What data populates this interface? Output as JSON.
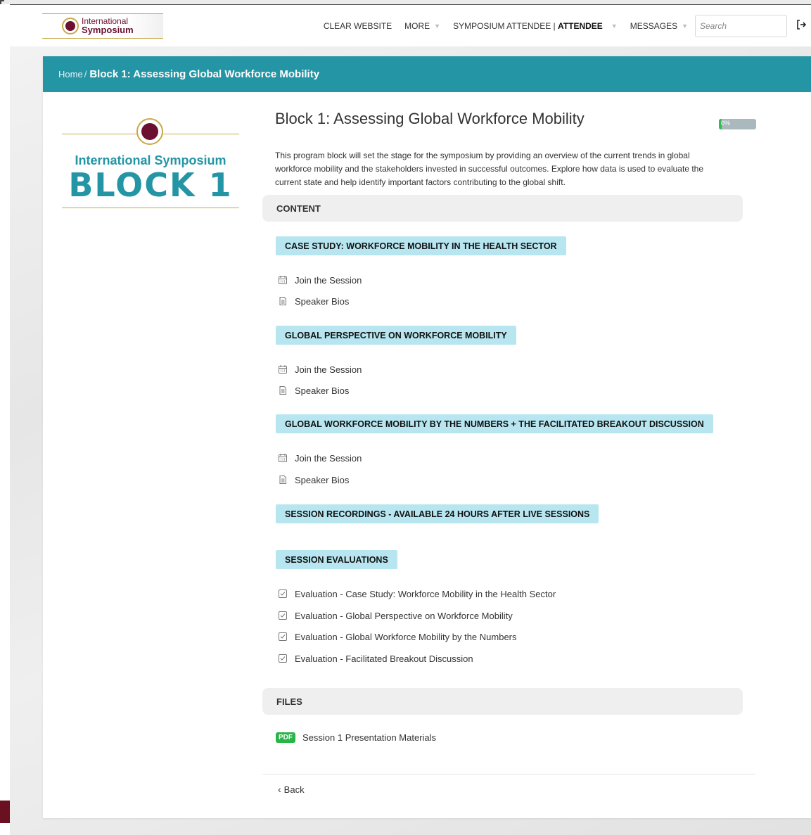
{
  "nav": {
    "logo_line1": "International",
    "logo_line2": "Symposium",
    "links": {
      "clear_website": "CLEAR WEBSITE",
      "more": "MORE",
      "attendee_prefix": "SYMPOSIUM ATTENDEE | ",
      "attendee_role": "ATTENDEE",
      "messages": "MESSAGES"
    },
    "search_placeholder": "Search"
  },
  "breadcrumb": {
    "home": "Home",
    "separator": "/",
    "current": "Block 1: Assessing Global Workforce Mobility"
  },
  "block_image": {
    "title": "International Symposium",
    "block": "BLOCK 1"
  },
  "page": {
    "title": "Block 1: Assessing Global Workforce Mobility",
    "progress_label": "0%",
    "progress_value": 0,
    "description": "This program block will set the stage for the symposium by providing an overview of the current trends in global workforce mobility and the stakeholders invested in successful outcomes. Explore how data is used to evaluate the current state and help identify important factors contributing to the global shift."
  },
  "content": {
    "heading": "CONTENT",
    "sessions": [
      {
        "title": "CASE STUDY: WORKFORCE MOBILITY IN THE HEALTH SECTOR",
        "join": "Join the Session",
        "bios": "Speaker Bios"
      },
      {
        "title": "GLOBAL PERSPECTIVE ON WORKFORCE MOBILITY",
        "join": "Join the Session",
        "bios": "Speaker Bios"
      },
      {
        "title": "GLOBAL WORKFORCE MOBILITY BY THE NUMBERS + THE FACILITATED BREAKOUT DISCUSSION",
        "join": "Join the Session",
        "bios": "Speaker Bios"
      }
    ],
    "recordings": "SESSION RECORDINGS - AVAILABLE 24 HOURS AFTER LIVE SESSIONS",
    "evaluations_heading": "SESSION EVALUATIONS",
    "evaluations": [
      "Evaluation - Case Study: Workforce Mobility in the Health Sector",
      "Evaluation - Global Perspective on Workforce Mobility",
      "Evaluation - Global Workforce Mobility by the Numbers",
      "Evaluation - Facilitated Breakout Discussion"
    ]
  },
  "files": {
    "heading": "FILES",
    "items": [
      {
        "badge": "PDF",
        "label": "Session 1 Presentation Materials"
      }
    ]
  },
  "back_label": "Back",
  "colors": {
    "header_teal": "#2495a4",
    "tag_blue": "#b7e6f1",
    "maroon": "#6b1030",
    "gold": "#c9a84a",
    "pdf_green": "#28b446"
  }
}
